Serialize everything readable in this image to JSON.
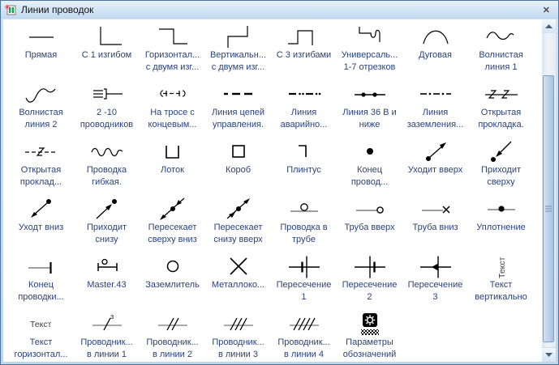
{
  "window": {
    "title": "Линии проводок",
    "close_glyph": "✕"
  },
  "colors": {
    "label_text": "#2a4379",
    "titlebar_top": "#e7f1fb",
    "titlebar_bottom": "#c3d9ef",
    "utility_line_gray": "#9e9e9e",
    "scrollbar_thumb": "#b4cce5"
  },
  "items": [
    {
      "label": "Прямая",
      "icon": "line-straight"
    },
    {
      "label": "С 1 изгибом",
      "icon": "line-one-bend"
    },
    {
      "label": "Горизонтал...\nс двумя изг...",
      "icon": "line-horiz-two-bends"
    },
    {
      "label": "Вертикальн...\nс двумя изг...",
      "icon": "line-vert-two-bends"
    },
    {
      "label": "С 3 изгибами",
      "icon": "line-three-bends"
    },
    {
      "label": "Универсаль...\n1-7 отрезков",
      "icon": "line-universal"
    },
    {
      "label": "Дуговая",
      "icon": "line-arc"
    },
    {
      "label": "Волнистая\nлиния 1",
      "icon": "line-wavy-1"
    },
    {
      "label": "Волнистая\nлиния 2",
      "icon": "line-wavy-2"
    },
    {
      "label": "2 -10\nпроводников",
      "icon": "conductors-2-10"
    },
    {
      "label": "На тросе с\nконцевым...",
      "icon": "cable-with-end"
    },
    {
      "label": "Линия цепей\nуправления.",
      "icon": "control-circuit-line"
    },
    {
      "label": "Линия\nаварийно...",
      "icon": "emergency-line"
    },
    {
      "label": "Линия 36 В и\nниже",
      "icon": "line-36v"
    },
    {
      "label": "Линия\nзаземления...",
      "icon": "grounding-line"
    },
    {
      "label": "Открытая\nпрокладка.",
      "icon": "open-laying-1"
    },
    {
      "label": "Открытая\nпроклад...",
      "icon": "open-laying-2"
    },
    {
      "label": "Проводка\nгибкая.",
      "icon": "flexible-wiring"
    },
    {
      "label": "Лоток",
      "icon": "tray"
    },
    {
      "label": "Короб",
      "icon": "box"
    },
    {
      "label": "Плинтус",
      "icon": "plinth"
    },
    {
      "label": "Конец\nпровод...",
      "icon": "wire-end-dot"
    },
    {
      "label": "Уходит вверх",
      "icon": "goes-up"
    },
    {
      "label": "Приходит\nсверху",
      "icon": "comes-from-above"
    },
    {
      "label": "Уходт вниз",
      "icon": "goes-down"
    },
    {
      "label": "Приходит\nснизу",
      "icon": "comes-from-below"
    },
    {
      "label": "Пересекает\nсверху вниз",
      "icon": "crosses-top-down"
    },
    {
      "label": "Пересекает\nснизу вверх",
      "icon": "crosses-bottom-up"
    },
    {
      "label": "Проводка в\nтрубе",
      "icon": "wiring-in-pipe"
    },
    {
      "label": "Труба вверх",
      "icon": "pipe-up"
    },
    {
      "label": "Труба вниз",
      "icon": "pipe-down"
    },
    {
      "label": "Уплотнение",
      "icon": "seal"
    },
    {
      "label": "Конец\nпроводки...",
      "icon": "wiring-end"
    },
    {
      "label": "Master.43",
      "icon": "master-43"
    },
    {
      "label": "Заземлитель",
      "icon": "grounder"
    },
    {
      "label": "Металлоко...",
      "icon": "metal-structure"
    },
    {
      "label": "Пересечение\n1",
      "icon": "intersection-1"
    },
    {
      "label": "Пересечение\n2",
      "icon": "intersection-2"
    },
    {
      "label": "Пересечение\n3",
      "icon": "intersection-3"
    },
    {
      "label": "Текст\nвертикально",
      "icon": "text-vertical",
      "icon_text": "Текст"
    },
    {
      "label": "Текст\nгоризонтал...",
      "icon": "text-horizontal",
      "icon_text": "Текст"
    },
    {
      "label": "Проводник...\nв линии 1",
      "icon": "conductors-in-line-1",
      "icon_text": "3"
    },
    {
      "label": "Проводник...\nв линии 2",
      "icon": "conductors-in-line-2"
    },
    {
      "label": "Проводник...\nв линии 3",
      "icon": "conductors-in-line-3"
    },
    {
      "label": "Проводник...\nв линии 4",
      "icon": "conductors-in-line-4"
    },
    {
      "label": "Параметры\nобозначений",
      "icon": "symbol-params"
    }
  ]
}
